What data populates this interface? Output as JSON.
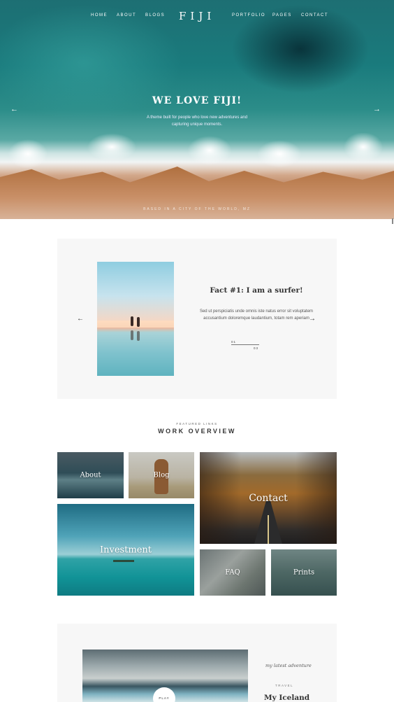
{
  "nav": {
    "left_items": [
      "HOME",
      "ABOUT",
      "BLOGS"
    ],
    "logo": "FIJI",
    "right_items": [
      "PORTFOLIO",
      "PAGES",
      "CONTACT"
    ]
  },
  "hero": {
    "title": "WE LOVE FIJI!",
    "subtitle": "A theme built for people who love new adventures and capturing unique moments.",
    "caption": "Based in a city of the world, MZ",
    "prev_arrow": "←",
    "next_arrow": "→"
  },
  "fact": {
    "title": "Fact #1: I am a surfer!",
    "text": "Sed ut perspiciatis unde omnis iste natus error sit voluptatem accusantium doloremque laudantium, totam rem aperiam",
    "prev_arrow": "←",
    "next_arrow": "→",
    "pager_current": "01",
    "pager_total": "03"
  },
  "work": {
    "eyebrow": "Featured Links",
    "title": "WORK OVERVIEW",
    "tiles": [
      "About",
      "Blog",
      "Contact",
      "Investment",
      "FAQ",
      "Prints"
    ]
  },
  "adventure": {
    "latest": "my latest adventure",
    "tag": "Travel",
    "title": "My Iceland",
    "play_label": "Play"
  },
  "icons": [
    "arrow-left-icon",
    "arrow-right-icon",
    "play-icon"
  ]
}
